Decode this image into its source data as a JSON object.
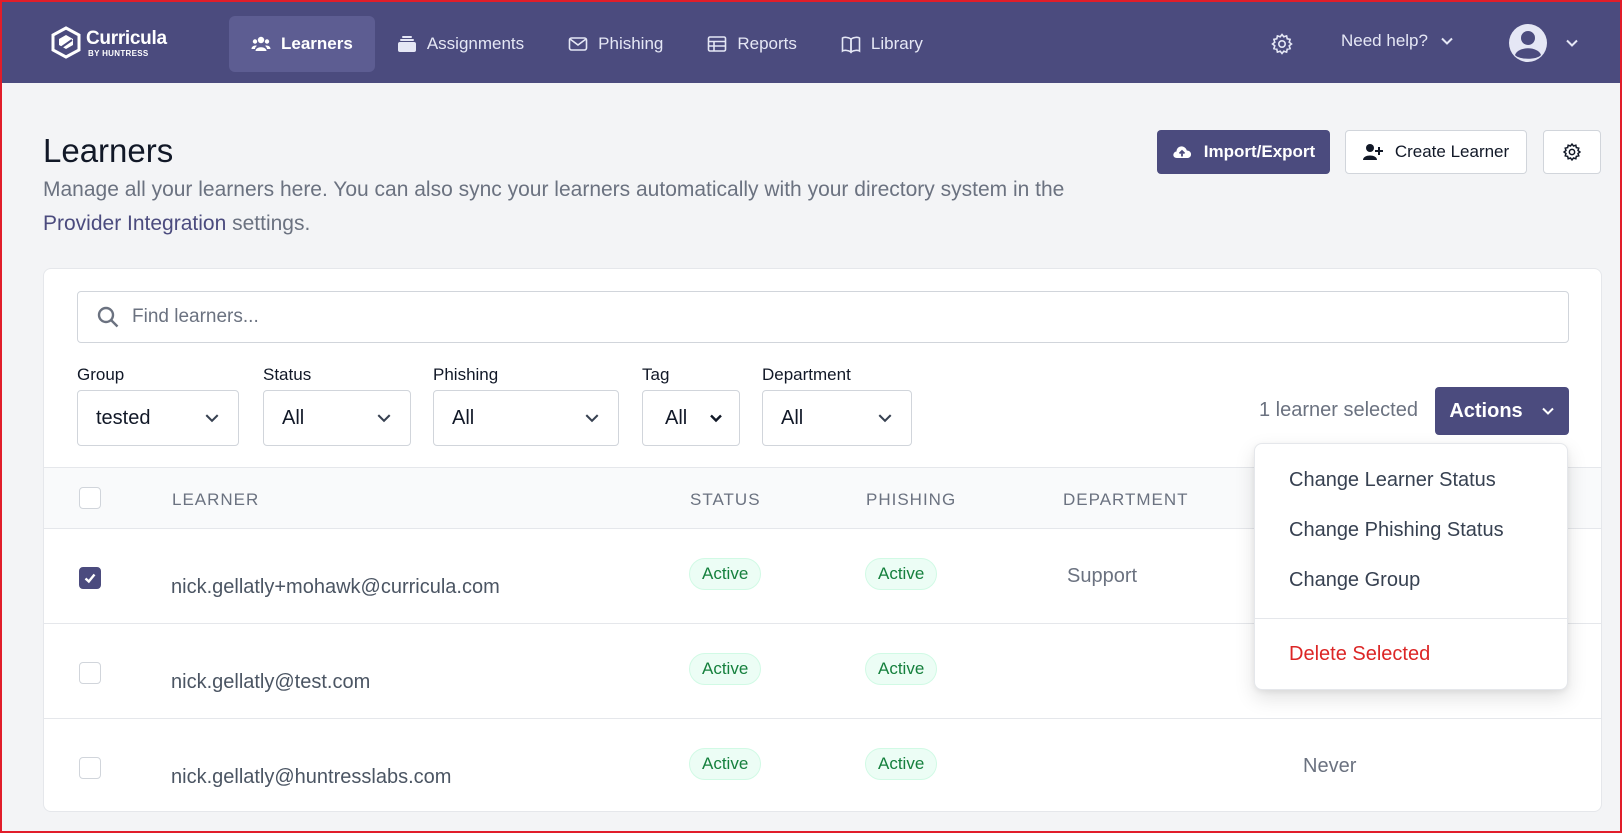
{
  "brand": {
    "name": "Curricula",
    "sub": "BY HUNTRESS"
  },
  "nav": {
    "items": [
      {
        "label": "Learners",
        "icon": "users-icon",
        "active": true
      },
      {
        "label": "Assignments",
        "icon": "stack-icon",
        "active": false
      },
      {
        "label": "Phishing",
        "icon": "envelope-icon",
        "active": false
      },
      {
        "label": "Reports",
        "icon": "table-icon",
        "active": false
      },
      {
        "label": "Library",
        "icon": "book-icon",
        "active": false
      }
    ],
    "help_label": "Need help?"
  },
  "header": {
    "title": "Learners",
    "description_before": "Manage all your learners here. You can also sync your learners automatically with your directory system in the ",
    "description_link": "Provider Integration",
    "description_after": " settings.",
    "import_export_label": "Import/Export",
    "create_learner_label": "Create Learner"
  },
  "search": {
    "placeholder": "Find learners...",
    "value": ""
  },
  "filters": {
    "group": {
      "label": "Group",
      "value": "tested"
    },
    "status": {
      "label": "Status",
      "value": "All"
    },
    "phishing": {
      "label": "Phishing",
      "value": "All"
    },
    "tag": {
      "label": "Tag",
      "value": "All"
    },
    "department": {
      "label": "Department",
      "value": "All"
    }
  },
  "selection": {
    "count_text": "1 learner selected",
    "actions_label": "Actions"
  },
  "table": {
    "columns": [
      "LEARNER",
      "STATUS",
      "PHISHING",
      "DEPARTMENT"
    ],
    "rows": [
      {
        "checked": true,
        "email": "nick.gellatly+mohawk@curricula.com",
        "status": "Active",
        "phishing": "Active",
        "department": "Support",
        "last": ""
      },
      {
        "checked": false,
        "email": "nick.gellatly@test.com",
        "status": "Active",
        "phishing": "Active",
        "department": "",
        "last": ""
      },
      {
        "checked": false,
        "email": "nick.gellatly@huntresslabs.com",
        "status": "Active",
        "phishing": "Active",
        "department": "",
        "last": "Never"
      }
    ]
  },
  "actions_menu": {
    "items": [
      "Change Learner Status",
      "Change Phishing Status",
      "Change Group"
    ],
    "danger_item": "Delete Selected"
  },
  "colors": {
    "primary": "#4b4b7e",
    "success": "#15803d",
    "danger": "#dc2626"
  }
}
